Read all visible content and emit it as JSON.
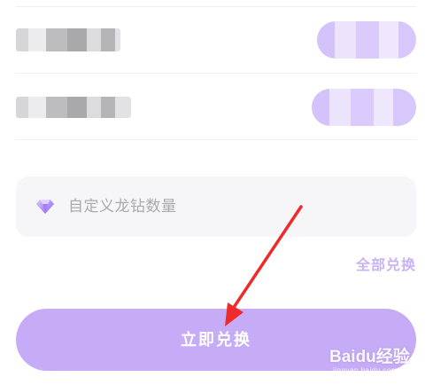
{
  "options": [
    {
      "label": "",
      "price": ""
    },
    {
      "label": "",
      "price": ""
    }
  ],
  "custom_amount": {
    "icon": "diamond-icon",
    "placeholder": "自定义龙钻数量"
  },
  "exchange_all_label": "全部兑换",
  "redeem_button_label": "立即兑换",
  "watermark": {
    "logo": "Baidu经验",
    "url": "jingyan.baidu.com"
  },
  "colors": {
    "accent": "#c6abf6",
    "accent_light": "#c9b3f5",
    "input_bg": "#f6f6f8",
    "placeholder_text": "#a9a9ae",
    "annotation_arrow": "#ee2a2a"
  }
}
